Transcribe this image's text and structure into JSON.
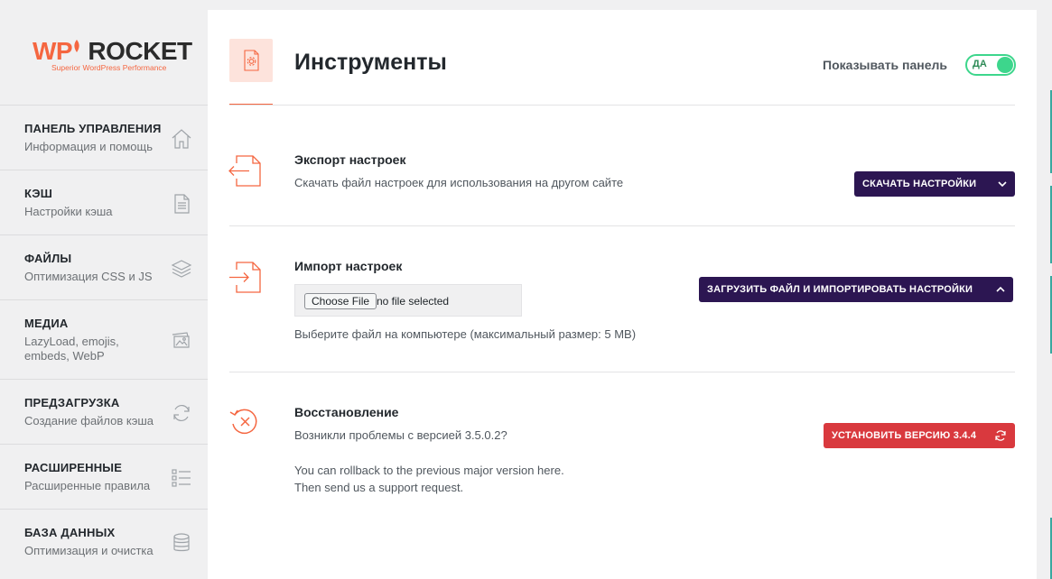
{
  "logo": {
    "wp": "WP",
    "rocket": "ROCKET",
    "tagline": "Superior WordPress Performance"
  },
  "sidebar": {
    "items": [
      {
        "title": "ПАНЕЛЬ УПРАВЛЕНИЯ",
        "subtitle": "Информация и помощь",
        "icon": "home-icon"
      },
      {
        "title": "КЭШ",
        "subtitle": "Настройки кэша",
        "icon": "document-icon"
      },
      {
        "title": "ФАЙЛЫ",
        "subtitle": "Оптимизация CSS и JS",
        "icon": "layers-icon"
      },
      {
        "title": "МЕДИА",
        "subtitle": "LazyLoad, emojis, embeds, WebP",
        "icon": "images-icon"
      },
      {
        "title": "ПРЕДЗАГРУЗКА",
        "subtitle": "Создание файлов кэша",
        "icon": "refresh-icon"
      },
      {
        "title": "РАСШИРЕННЫЕ",
        "subtitle": "Расширенные правила",
        "icon": "checklist-icon"
      },
      {
        "title": "БАЗА ДАННЫХ",
        "subtitle": "Оптимизация и очистка",
        "icon": "database-icon"
      }
    ]
  },
  "header": {
    "title": "Инструменты",
    "toggle_label": "Показывать панель",
    "toggle_state": "ДА"
  },
  "export": {
    "title": "Экспорт настроек",
    "desc": "Скачать файл настроек для использования на другом сайте",
    "button": "СКАЧАТЬ НАСТРОЙКИ"
  },
  "import": {
    "title": "Импорт настроек",
    "choose_file": "Choose File",
    "file_status": "no file selected",
    "hint": "Выберите файл на компьютере (максимальный размер: 5 MB)",
    "button": "ЗАГРУЗИТЬ ФАЙЛ И ИМПОРТИРОВАТЬ НАСТРОЙКИ"
  },
  "rollback": {
    "title": "Восстановление",
    "desc": "Возникли проблемы с версией 3.5.0.2?",
    "note_line1": "You can rollback to the previous major version here.",
    "note_line2": "Then send us a support request.",
    "button": "УСТАНОВИТЬ ВЕРСИЮ 3.4.4"
  },
  "colors": {
    "accent": "#f56640",
    "primary_button": "#2c1652",
    "danger_button": "#d9393e",
    "toggle_on": "#3dd68c"
  }
}
